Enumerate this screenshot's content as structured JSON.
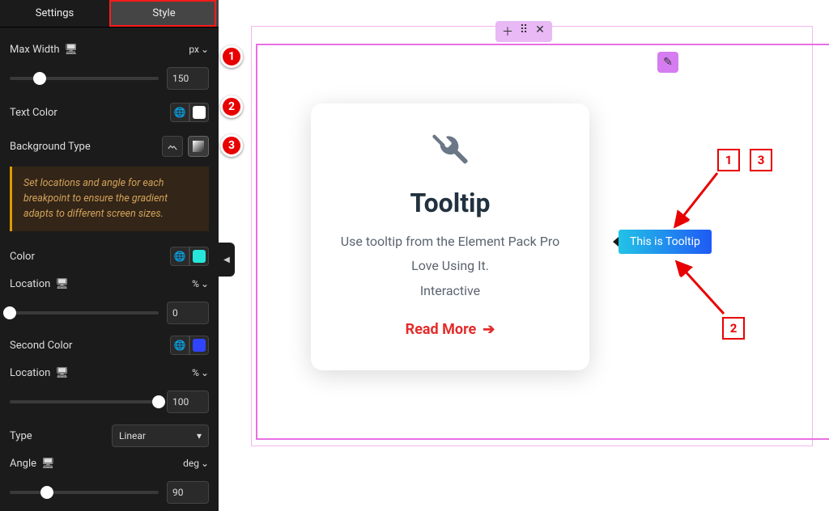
{
  "tabs": {
    "settings": "Settings",
    "style": "Style"
  },
  "maxWidth": {
    "label": "Max Width",
    "unit": "px",
    "value": "150"
  },
  "textColor": {
    "label": "Text Color",
    "value": "#ffffff"
  },
  "backgroundType": {
    "label": "Background Type"
  },
  "hint": "Set locations and angle for each breakpoint to ensure the gradient adapts to different screen sizes.",
  "color": {
    "label": "Color",
    "value": "#26e6d9"
  },
  "colorLocation": {
    "label": "Location",
    "unit": "%",
    "value": "0"
  },
  "secondColor": {
    "label": "Second Color",
    "value": "#3044ff"
  },
  "secondLocation": {
    "label": "Location",
    "unit": "%",
    "value": "100"
  },
  "type": {
    "label": "Type",
    "value": "Linear"
  },
  "angle": {
    "label": "Angle",
    "unit": "deg",
    "value": "90"
  },
  "card": {
    "title": "Tooltip",
    "line1": "Use tooltip from the Element Pack Pro",
    "line2": "Love Using It.",
    "line3": "Interactive",
    "link": "Read More"
  },
  "tooltip": "This is Tooltip",
  "annotations": {
    "b1": "1",
    "b2": "2",
    "b3": "3",
    "s1": "1",
    "s2": "2",
    "s3": "3"
  }
}
